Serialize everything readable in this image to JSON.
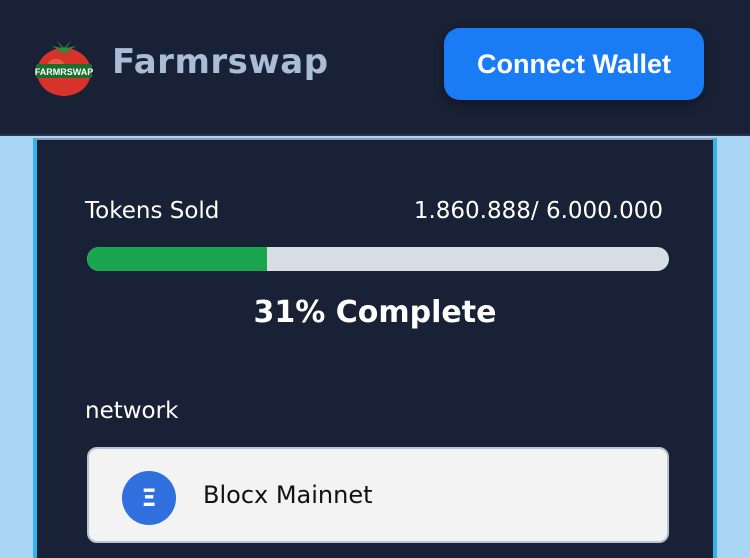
{
  "header": {
    "logo_text": "FARMRSWAP",
    "brand": "Farmrswap",
    "connect_label": "Connect Wallet"
  },
  "sale": {
    "tokens_label": "Tokens Sold",
    "tokens_value": "1.860.888/ 6.000.000",
    "progress_fraction": 0.31,
    "complete_text": "31% Complete"
  },
  "network": {
    "label": "network",
    "selected": "Blocx Mainnet",
    "icon": "blocx-icon",
    "icon_glyph": "Ξ"
  },
  "colors": {
    "header_bg": "#192136",
    "accent_blue": "#1a7cf5",
    "progress_green": "#1aa64f",
    "card_border": "#35b3e8"
  }
}
